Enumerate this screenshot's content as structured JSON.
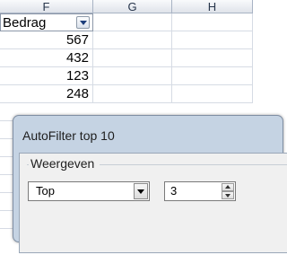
{
  "spreadsheet": {
    "columns": [
      "F",
      "G",
      "H"
    ],
    "filter_header": "Bedrag",
    "values": [
      "567",
      "432",
      "123",
      "248"
    ]
  },
  "dialog": {
    "title": "AutoFilter top 10",
    "group_label": "Weergeven",
    "type_value": "Top",
    "count_value": "3"
  }
}
